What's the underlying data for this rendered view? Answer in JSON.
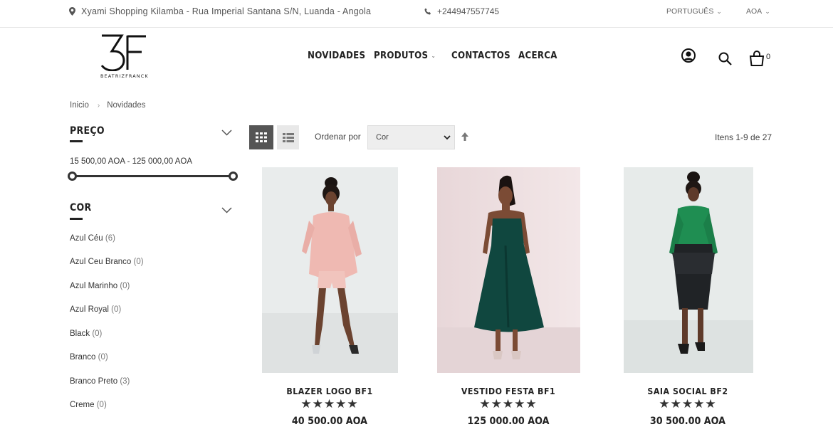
{
  "topbar": {
    "address": "Xyami Shopping Kilamba - Rua Imperial Santana S/N, Luanda - Angola",
    "phone": "+244947557745",
    "language": "PORTUGUÊS",
    "currency": "AOA"
  },
  "logo": {
    "brand": "BEATRIZFRANCK"
  },
  "nav": {
    "items": [
      {
        "label": "NOVIDADES"
      },
      {
        "label": "PRODUTOS"
      },
      {
        "label": "CONTACTOS"
      },
      {
        "label": "ACERCA"
      }
    ]
  },
  "header": {
    "cart_count": "0"
  },
  "breadcrumb": {
    "home": "Inicio",
    "current": "Novidades"
  },
  "filters": {
    "price": {
      "title": "PREÇO",
      "range_text": "15 500,00 AOA - 125 000,00 AOA"
    },
    "color": {
      "title": "COR",
      "items": [
        {
          "label": "Azul Céu",
          "count": "(6)"
        },
        {
          "label": "Azul Ceu Branco",
          "count": "(0)"
        },
        {
          "label": "Azul Marinho",
          "count": "(0)"
        },
        {
          "label": "Azul Royal",
          "count": "(0)"
        },
        {
          "label": "Black",
          "count": "(0)"
        },
        {
          "label": "Branco",
          "count": "(0)"
        },
        {
          "label": "Branco Preto",
          "count": "(3)"
        },
        {
          "label": "Creme",
          "count": "(0)"
        }
      ]
    }
  },
  "toolbar": {
    "sort_label": "Ordenar por",
    "sort_value": "Cor",
    "items_count": "Itens 1-9 de 27"
  },
  "products": [
    {
      "name": "BLAZER LOGO BF1",
      "stars": "★★★★★",
      "price": "40 500.00 AOA",
      "rating": 5
    },
    {
      "name": "VESTIDO FESTA BF1",
      "stars": "★★★★★",
      "price": "125 000.00 AOA",
      "rating": 5
    },
    {
      "name": "SAIA SOCIAL BF2",
      "stars": "★★★★★",
      "price": "30 500.00 AOA",
      "rating": 5
    }
  ],
  "colors": {
    "accent": "#222222",
    "grid_button": "#555555"
  }
}
